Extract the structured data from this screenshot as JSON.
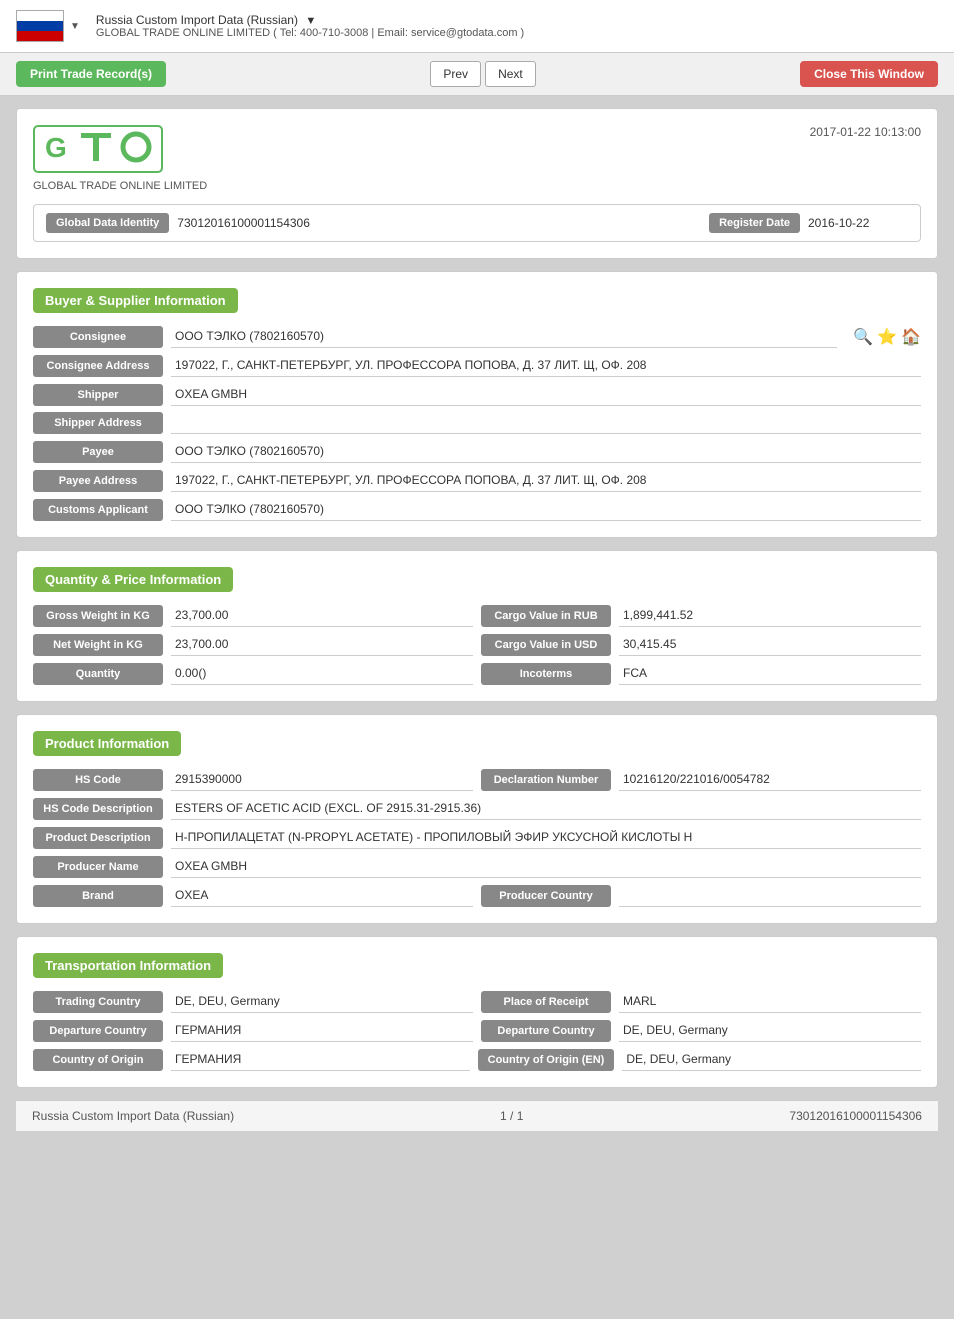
{
  "header": {
    "title": "Russia Custom Import Data (Russian)",
    "title_arrow": "▼",
    "subtitle": "GLOBAL TRADE ONLINE LIMITED ( Tel: 400-710-3008 | Email: service@gtodata.com )"
  },
  "toolbar": {
    "print_label": "Print Trade Record(s)",
    "prev_label": "Prev",
    "next_label": "Next",
    "close_label": "Close This Window"
  },
  "record": {
    "timestamp": "2017-01-22 10:13:00",
    "logo_sub": "GLOBAL TRADE ONLINE LIMITED",
    "global_data_identity_label": "Global Data Identity",
    "global_data_identity_value": "73012016100001154306",
    "register_date_label": "Register Date",
    "register_date_value": "2016-10-22"
  },
  "buyer_supplier": {
    "section_label": "Buyer & Supplier Information",
    "consignee_label": "Consignee",
    "consignee_value": "ООО ТЭЛКО (7802160570)",
    "consignee_address_label": "Consignee Address",
    "consignee_address_value": "197022, Г., САНКТ-ПЕТЕРБУРГ, УЛ. ПРОФЕССОРА ПОПОВА, Д. 37 ЛИТ. Щ, ОФ. 208",
    "shipper_label": "Shipper",
    "shipper_value": "OXEA GMBH",
    "shipper_address_label": "Shipper Address",
    "shipper_address_value": "",
    "payee_label": "Payee",
    "payee_value": "ООО ТЭЛКО  (7802160570)",
    "payee_address_label": "Payee Address",
    "payee_address_value": "197022, Г., САНКТ-ПЕТЕРБУРГ, УЛ. ПРОФЕССОРА ПОПОВА, Д. 37 ЛИТ. Щ, ОФ. 208",
    "customs_applicant_label": "Customs Applicant",
    "customs_applicant_value": "ООО ТЭЛКО  (7802160570)"
  },
  "quantity_price": {
    "section_label": "Quantity & Price Information",
    "gross_weight_label": "Gross Weight in KG",
    "gross_weight_value": "23,700.00",
    "cargo_value_rub_label": "Cargo Value in RUB",
    "cargo_value_rub_value": "1,899,441.52",
    "net_weight_label": "Net Weight in KG",
    "net_weight_value": "23,700.00",
    "cargo_value_usd_label": "Cargo Value in USD",
    "cargo_value_usd_value": "30,415.45",
    "quantity_label": "Quantity",
    "quantity_value": "0.00()",
    "incoterms_label": "Incoterms",
    "incoterms_value": "FCA"
  },
  "product_info": {
    "section_label": "Product Information",
    "hs_code_label": "HS Code",
    "hs_code_value": "2915390000",
    "declaration_number_label": "Declaration Number",
    "declaration_number_value": "10216120/221016/0054782",
    "hs_code_desc_label": "HS Code Description",
    "hs_code_desc_value": "ESTERS OF ACETIC ACID (EXCL. OF 2915.31-2915.36)",
    "product_desc_label": "Product Description",
    "product_desc_value": "Н-ПРОПИЛАЦЕТАТ (N-PROPYL ACETATE) - ПРОПИЛОВЫЙ ЭФИР УКСУСНОЙ КИСЛОТЫ Н",
    "producer_name_label": "Producer Name",
    "producer_name_value": "OXEA GMBH",
    "brand_label": "Brand",
    "brand_value": "OXEA",
    "producer_country_label": "Producer Country",
    "producer_country_value": ""
  },
  "transportation": {
    "section_label": "Transportation Information",
    "trading_country_label": "Trading Country",
    "trading_country_value": "DE, DEU, Germany",
    "place_of_receipt_label": "Place of Receipt",
    "place_of_receipt_value": "MARL",
    "departure_country_label": "Departure Country",
    "departure_country_value": "ГЕРМАНИЯ",
    "departure_country2_label": "Departure Country",
    "departure_country2_value": "DE, DEU, Germany",
    "country_of_origin_label": "Country of Origin",
    "country_of_origin_value": "ГЕРМАНИЯ",
    "country_of_origin_en_label": "Country of Origin (EN)",
    "country_of_origin_en_value": "DE, DEU, Germany"
  },
  "footer": {
    "left": "Russia Custom Import Data (Russian)",
    "center": "1 / 1",
    "right": "73012016100001154306"
  }
}
